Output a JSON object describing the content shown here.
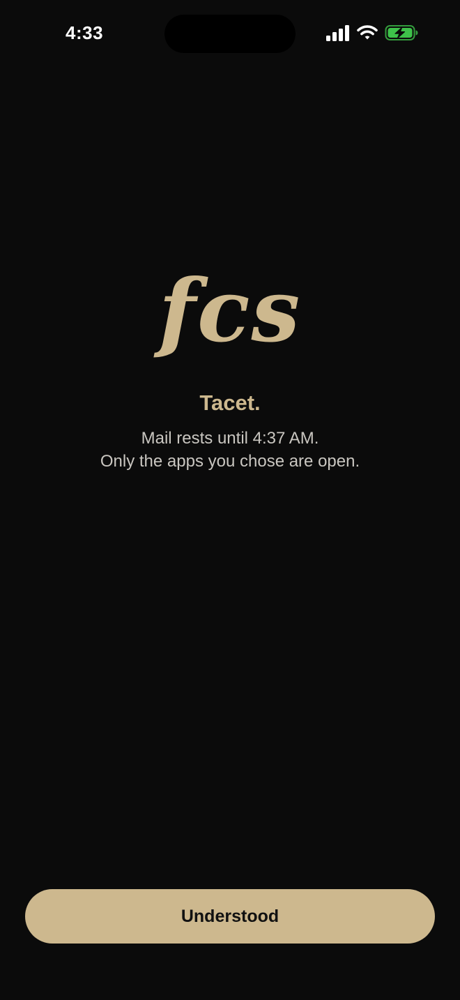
{
  "status_bar": {
    "time": "4:33",
    "icons": [
      "cellular-signal-icon",
      "wifi-icon",
      "battery-charging-icon"
    ],
    "battery_color": "#3ec24a"
  },
  "logo": {
    "text": "fcs",
    "color": "#cdb88e"
  },
  "headline": "Tacet.",
  "message": {
    "line1": "Mail rests until 4:37 AM.",
    "line2": "Only the apps you chose are open."
  },
  "primary_button": {
    "label": "Understood",
    "color": "#cdb88e"
  },
  "background_color": "#0b0b0b"
}
